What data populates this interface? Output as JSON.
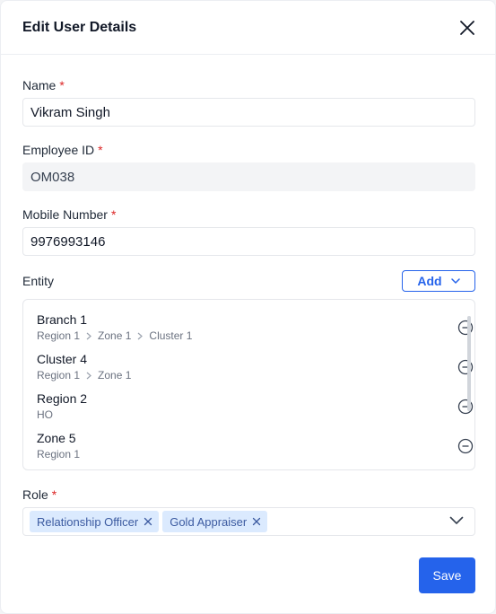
{
  "dialog": {
    "title": "Edit User Details"
  },
  "fields": {
    "name": {
      "label": "Name",
      "required": "*",
      "value": "Vikram Singh"
    },
    "employee_id": {
      "label": "Employee ID",
      "required": "*",
      "value": "OM038"
    },
    "mobile": {
      "label": "Mobile Number",
      "required": "*",
      "value": "9976993146"
    }
  },
  "entity": {
    "label": "Entity",
    "add_label": "Add",
    "items": [
      {
        "name": "Branch 1",
        "path": [
          "Region 1",
          "Zone 1",
          "Cluster 1"
        ]
      },
      {
        "name": "Cluster 4",
        "path": [
          "Region 1",
          "Zone 1"
        ]
      },
      {
        "name": "Region 2",
        "path": [
          "HO"
        ]
      },
      {
        "name": "Zone 5",
        "path": [
          "Region 1"
        ]
      }
    ]
  },
  "role": {
    "label": "Role",
    "required": "*",
    "selected": [
      "Relationship Officer",
      "Gold Appraiser"
    ]
  },
  "actions": {
    "save_label": "Save"
  },
  "colors": {
    "accent": "#2563eb",
    "required": "#dc2626",
    "chip_bg": "#dbeafe"
  }
}
